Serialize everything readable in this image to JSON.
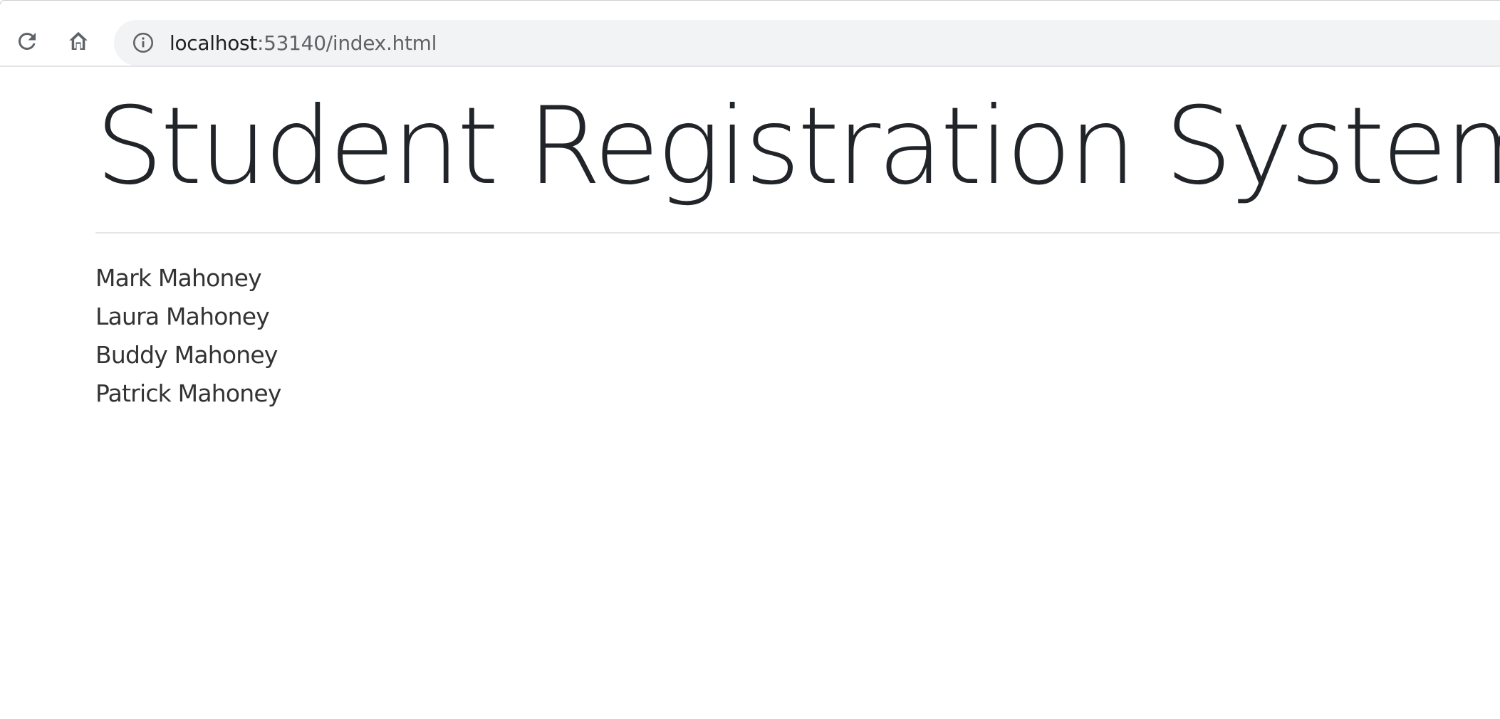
{
  "browser": {
    "url_host": "localhost",
    "url_rest": ":53140/index.html",
    "icons": {
      "reload": "reload-icon",
      "home": "home-icon",
      "site_info": "info-icon"
    }
  },
  "page": {
    "title": "Student Registration System",
    "students": [
      "Mark Mahoney",
      "Laura Mahoney",
      "Buddy Mahoney",
      "Patrick Mahoney"
    ]
  },
  "colors": {
    "text_primary": "#212529",
    "text_body": "#333333",
    "omnibox_bg": "#f1f3f4",
    "url_secondary": "#5f6368",
    "divider": "#e5e5e5"
  }
}
